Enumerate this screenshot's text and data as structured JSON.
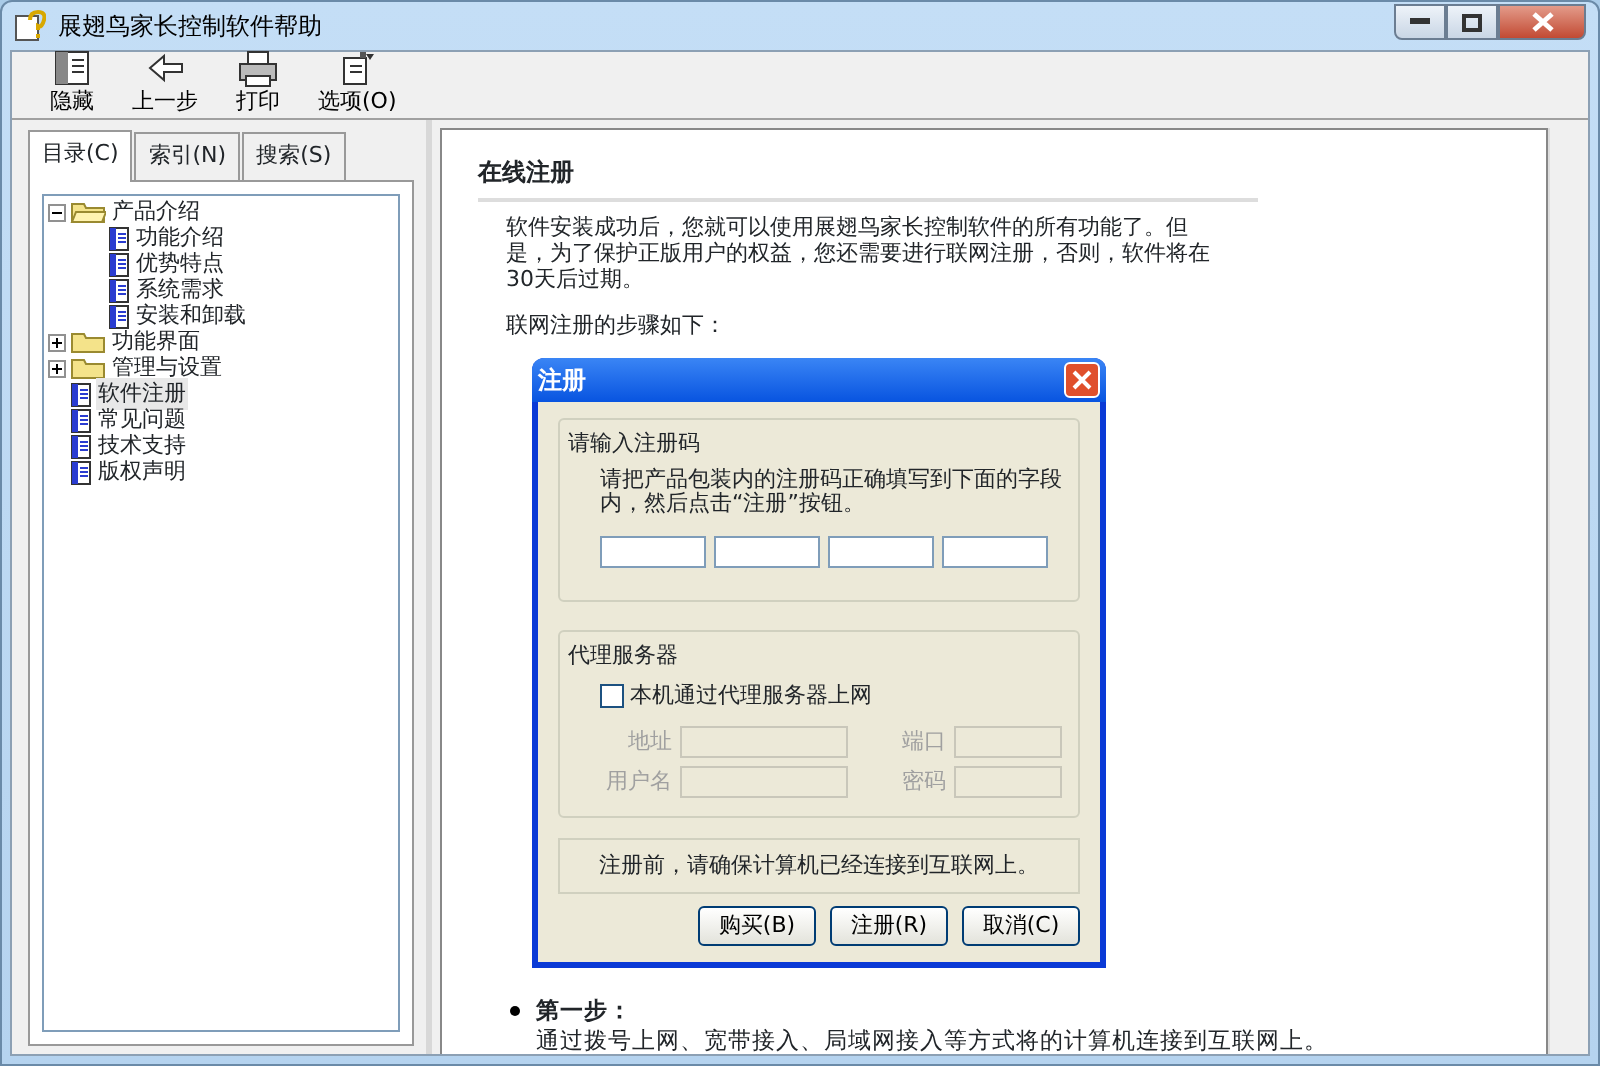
{
  "window": {
    "title": "展翅鸟家长控制软件帮助"
  },
  "toolbar": [
    {
      "kind": "hide",
      "label": "隐藏"
    },
    {
      "kind": "back",
      "label": "上一步"
    },
    {
      "kind": "print",
      "label": "打印"
    },
    {
      "kind": "options",
      "label": "选项(O)"
    }
  ],
  "tabs": [
    {
      "label": "目录(C)",
      "selected": true
    },
    {
      "label": "索引(N)",
      "selected": false
    },
    {
      "label": "搜索(S)",
      "selected": false
    }
  ],
  "tree": [
    {
      "kind": "folder",
      "label": "产品介绍",
      "expanded": true,
      "selected": false,
      "children": [
        {
          "kind": "page",
          "label": "功能介绍",
          "selected": false
        },
        {
          "kind": "page",
          "label": "优势特点",
          "selected": false
        },
        {
          "kind": "page",
          "label": "系统需求",
          "selected": false
        },
        {
          "kind": "page",
          "label": "安装和卸载",
          "selected": false
        }
      ]
    },
    {
      "kind": "folder",
      "label": "功能界面",
      "expanded": false,
      "selected": false
    },
    {
      "kind": "folder",
      "label": "管理与设置",
      "expanded": false,
      "selected": false
    },
    {
      "kind": "page",
      "label": "软件注册",
      "selected": true
    },
    {
      "kind": "page",
      "label": "常见问题",
      "selected": false
    },
    {
      "kind": "page",
      "label": "技术支持",
      "selected": false
    },
    {
      "kind": "page",
      "label": "版权声明",
      "selected": false
    }
  ],
  "content": {
    "title": "在线注册",
    "intro": "软件安装成功后，您就可以使用展翅鸟家长控制软件的所有功能了。但是，为了保护正版用户的权益，您还需要进行联网注册，否则，软件将在30天后过期。",
    "steps_intro": "联网注册的步骤如下：",
    "dialog": {
      "title": "注册",
      "code_group": {
        "legend": "请输入注册码",
        "text": "请把产品包装内的注册码正确填写到下面的字段内，然后点击“注册”按钮。"
      },
      "proxy_group": {
        "legend": "代理服务器",
        "checkbox": {
          "label": "本机通过代理服务器上网",
          "checked": false
        },
        "fields": [
          {
            "label": "地址",
            "disabled": true
          },
          {
            "label": "端口",
            "disabled": true
          },
          {
            "label": "用户名",
            "disabled": true
          },
          {
            "label": "密码",
            "disabled": true
          }
        ]
      },
      "note": "注册前，请确保计算机已经连接到互联网上。",
      "buttons": [
        "购买(B)",
        "注册(R)",
        "取消(C)"
      ]
    },
    "steps": [
      {
        "title": "第一步：",
        "text": "通过拨号上网、宽带接入、局域网接入等方式将的计算机连接到互联网上。"
      }
    ]
  }
}
